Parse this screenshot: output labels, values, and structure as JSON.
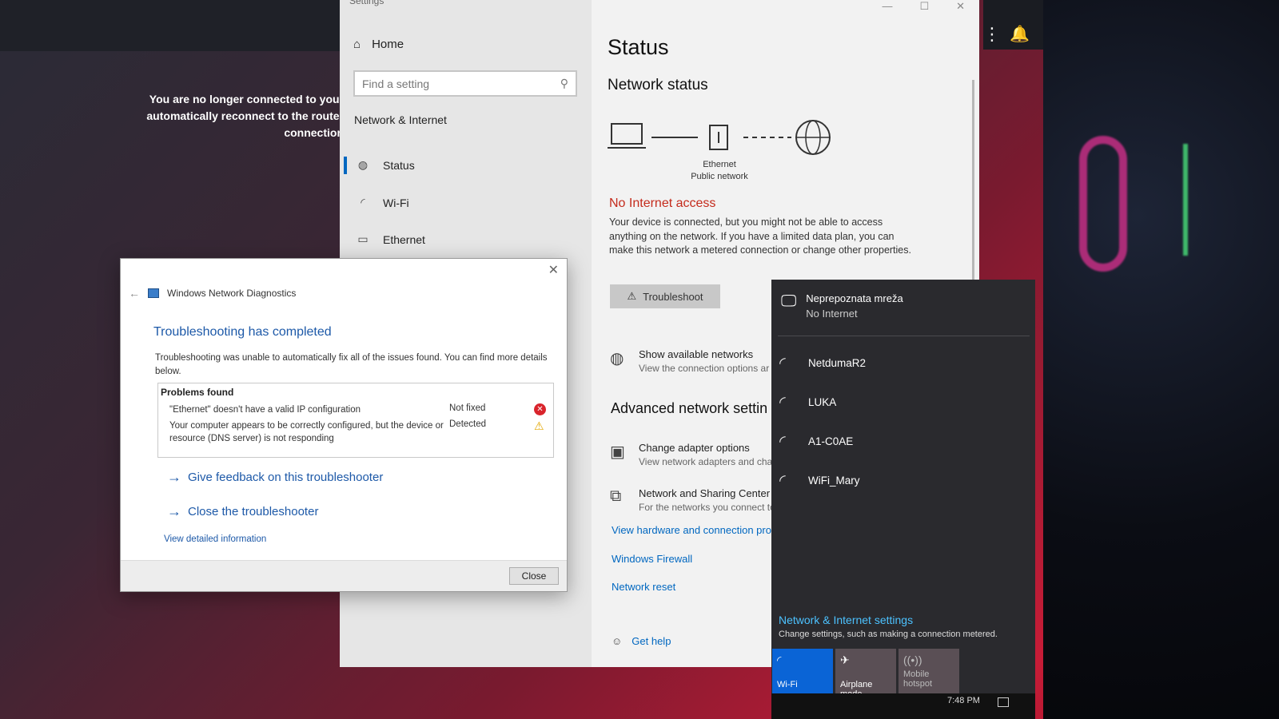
{
  "desktop": {
    "message": "You are no longer connected to your automatically reconnect to the router connection"
  },
  "settings": {
    "window_title": "Settings",
    "home_label": "Home",
    "search_placeholder": "Find a setting",
    "section": "Network & Internet",
    "nav": [
      {
        "label": "Status",
        "icon": "globe-icon"
      },
      {
        "label": "Wi-Fi",
        "icon": "wifi-icon"
      },
      {
        "label": "Ethernet",
        "icon": "ethernet-icon"
      }
    ],
    "page_title": "Status",
    "network_status_heading": "Network status",
    "diagram_label": "Ethernet",
    "diagram_sublabel": "Public network",
    "no_internet": "No Internet access",
    "description": "Your device is connected, but you might not be able to access anything on the network. If you have a limited data plan, you can make this network a metered connection or change other properties.",
    "troubleshoot_label": "Troubleshoot",
    "show_networks_title": "Show available networks",
    "show_networks_sub": "View the connection options ar",
    "advanced_heading": "Advanced network settin",
    "adapter_title": "Change adapter options",
    "adapter_sub": "View network adapters and cha",
    "sharing_title": "Network and Sharing Center",
    "sharing_sub": "For the networks you connect to",
    "links": [
      "View hardware and connection pro",
      "Windows Firewall",
      "Network reset"
    ],
    "get_help": "Get help"
  },
  "flyout": {
    "connected_name": "Neprepoznata mreža",
    "connected_status": "No Internet",
    "networks": [
      "NetdumaR2",
      "LUKA",
      "A1-C0AE",
      "WiFi_Mary"
    ],
    "settings_link": "Network & Internet settings",
    "settings_sub": "Change settings, such as making a connection metered.",
    "tiles": [
      {
        "label": "Wi-Fi",
        "active": true
      },
      {
        "label": "Airplane mode",
        "active": false
      },
      {
        "label": "Mobile hotspot",
        "active": false
      }
    ],
    "time": "7:48 PM"
  },
  "diagnostics": {
    "title": "Windows Network Diagnostics",
    "heading": "Troubleshooting has completed",
    "description": "Troubleshooting was unable to automatically fix all of the issues found. You can find more details below.",
    "problems_title": "Problems found",
    "problems": [
      {
        "text": "\"Ethernet\" doesn't have a valid IP configuration",
        "status": "Not fixed"
      },
      {
        "text": "Your computer appears to be correctly configured, but the device or resource (DNS server) is not responding",
        "status": "Detected"
      }
    ],
    "feedback_link": "Give feedback on this troubleshooter",
    "close_link": "Close the troubleshooter",
    "detail_link": "View detailed information",
    "close_button": "Close"
  },
  "colors": {
    "accent_blue": "#0067c0",
    "error_red": "#c42b1c",
    "flyout_bg": "#2a2a2e",
    "link_cyan": "#4cc2ff"
  }
}
